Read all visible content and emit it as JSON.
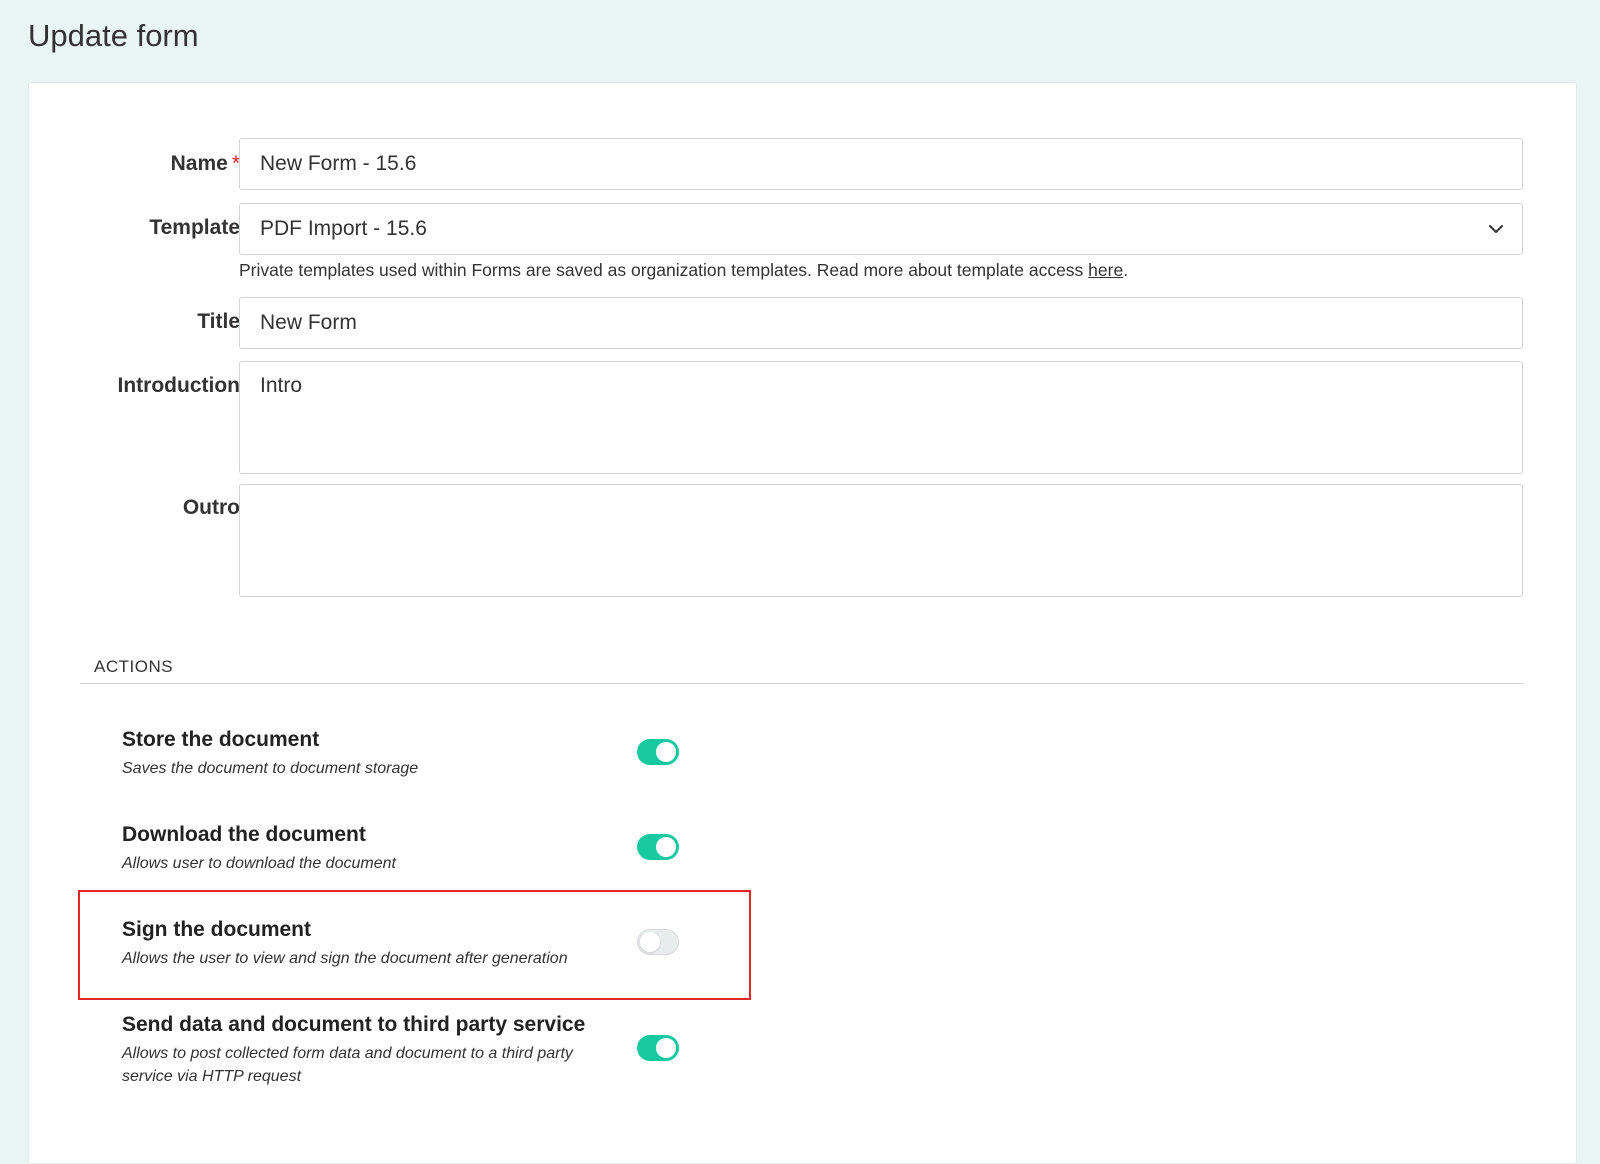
{
  "page": {
    "title": "Update form"
  },
  "form": {
    "name": {
      "label": "Name",
      "required_mark": "*",
      "value": "New Form - 15.6"
    },
    "template": {
      "label": "Template",
      "selected": "PDF Import - 15.6",
      "help_text": "Private templates used within Forms are saved as organization templates. Read more about template access ",
      "help_link": "here",
      "help_end": "."
    },
    "title": {
      "label": "Title",
      "value": "New Form"
    },
    "introduction": {
      "label": "Introduction",
      "value": "Intro"
    },
    "outro": {
      "label": "Outro",
      "value": ""
    }
  },
  "actions": {
    "section_title": "ACTIONS",
    "items": [
      {
        "title": "Store the document",
        "description": "Saves the document to document storage",
        "enabled": true
      },
      {
        "title": "Download the document",
        "description": "Allows user to download the document",
        "enabled": true
      },
      {
        "title": "Sign the document",
        "description": "Allows the user to view and sign the document after generation",
        "enabled": false
      },
      {
        "title": "Send data and document to third party service",
        "description": "Allows to post collected form data and document to a third party service via HTTP request",
        "enabled": true
      }
    ]
  },
  "colors": {
    "background": "#e8f5f2",
    "toggle_on": "#16c9a0",
    "highlight": "#e32626",
    "required": "#e02020"
  },
  "icons": {
    "template_dropdown": "chevron-down-icon"
  }
}
